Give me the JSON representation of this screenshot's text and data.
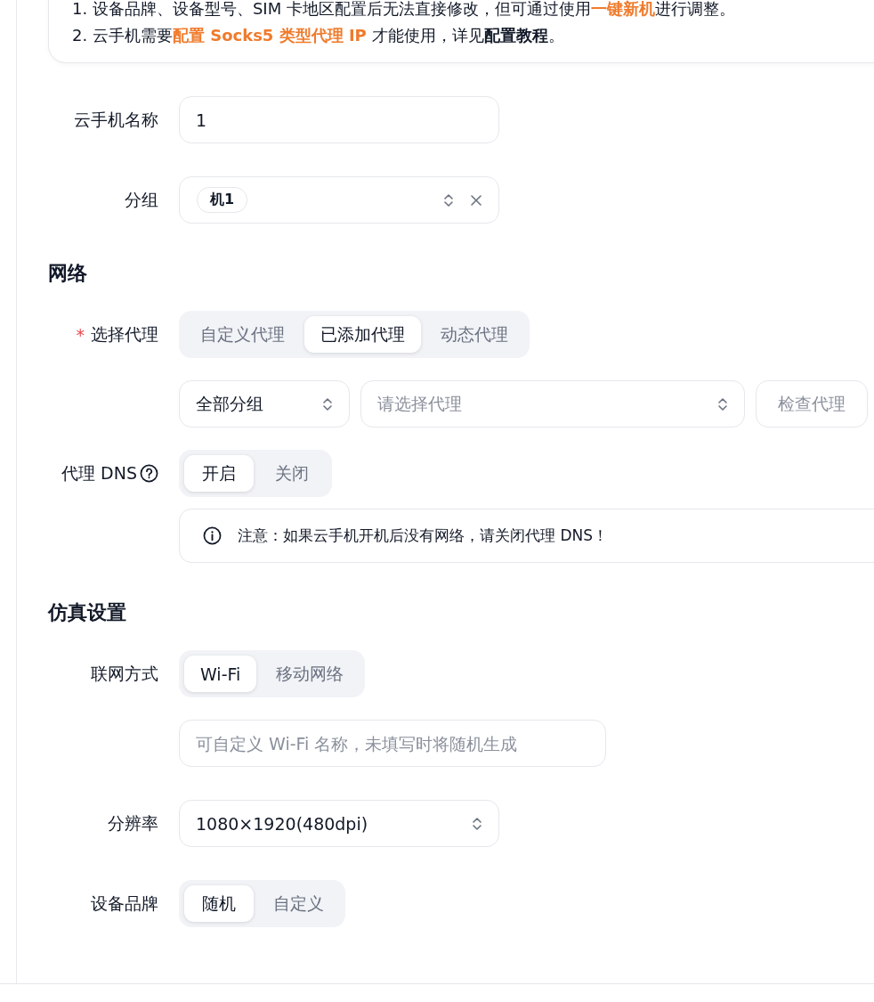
{
  "notice": {
    "lines": [
      [
        {
          "kind": "text",
          "text": "1. 设备品牌、设备型号、SIM 卡地区配置后无法直接修改，但可通过使用"
        },
        {
          "kind": "highlight",
          "text": "一键新机"
        },
        {
          "kind": "text",
          "text": "进行调整。"
        }
      ],
      [
        {
          "kind": "text",
          "text": "2. 云手机需要"
        },
        {
          "kind": "highlight",
          "text": "配置 Socks5 类型代理 IP"
        },
        {
          "kind": "text",
          "text": " 才能使用，详见"
        },
        {
          "kind": "link",
          "text": "配置教程"
        },
        {
          "kind": "text",
          "text": "。"
        }
      ]
    ]
  },
  "fields": [
    {
      "kind": "input",
      "label": "云手机名称",
      "value": "1"
    },
    {
      "kind": "tag_select",
      "label": "分组",
      "tags": [
        "机1"
      ]
    },
    {
      "kind": "heading",
      "text": "网络"
    },
    {
      "kind": "segmented",
      "label": "选择代理",
      "required_mark": "*",
      "options": [
        {
          "label": "自定义代理",
          "selected": false
        },
        {
          "label": "已添加代理",
          "selected": true
        },
        {
          "label": "动态代理",
          "selected": false
        }
      ]
    },
    {
      "kind": "select_row",
      "selects": [
        {
          "value": "全部分组"
        },
        {
          "placeholder": "请选择代理"
        }
      ],
      "button": "检查代理"
    },
    {
      "kind": "segmented",
      "label": "代理 DNS",
      "help": true,
      "options": [
        {
          "label": "开启",
          "selected": true
        },
        {
          "label": "关闭",
          "selected": false
        }
      ]
    },
    {
      "kind": "alert",
      "text": "注意：如果云手机开机后没有网络，请关闭代理 DNS！"
    },
    {
      "kind": "heading",
      "text": "仿真设置"
    },
    {
      "kind": "segmented",
      "label": "联网方式",
      "options": [
        {
          "label": "Wi-Fi",
          "selected": true
        },
        {
          "label": "移动网络",
          "selected": false
        }
      ]
    },
    {
      "kind": "input",
      "placeholder": "可自定义 Wi-Fi 名称，未填写时将随机生成"
    },
    {
      "kind": "select",
      "label": "分辨率",
      "value": "1080×1920(480dpi)"
    },
    {
      "kind": "segmented",
      "label": "设备品牌",
      "options": [
        {
          "label": "随机",
          "selected": true
        },
        {
          "label": "自定义",
          "selected": false
        }
      ]
    }
  ]
}
